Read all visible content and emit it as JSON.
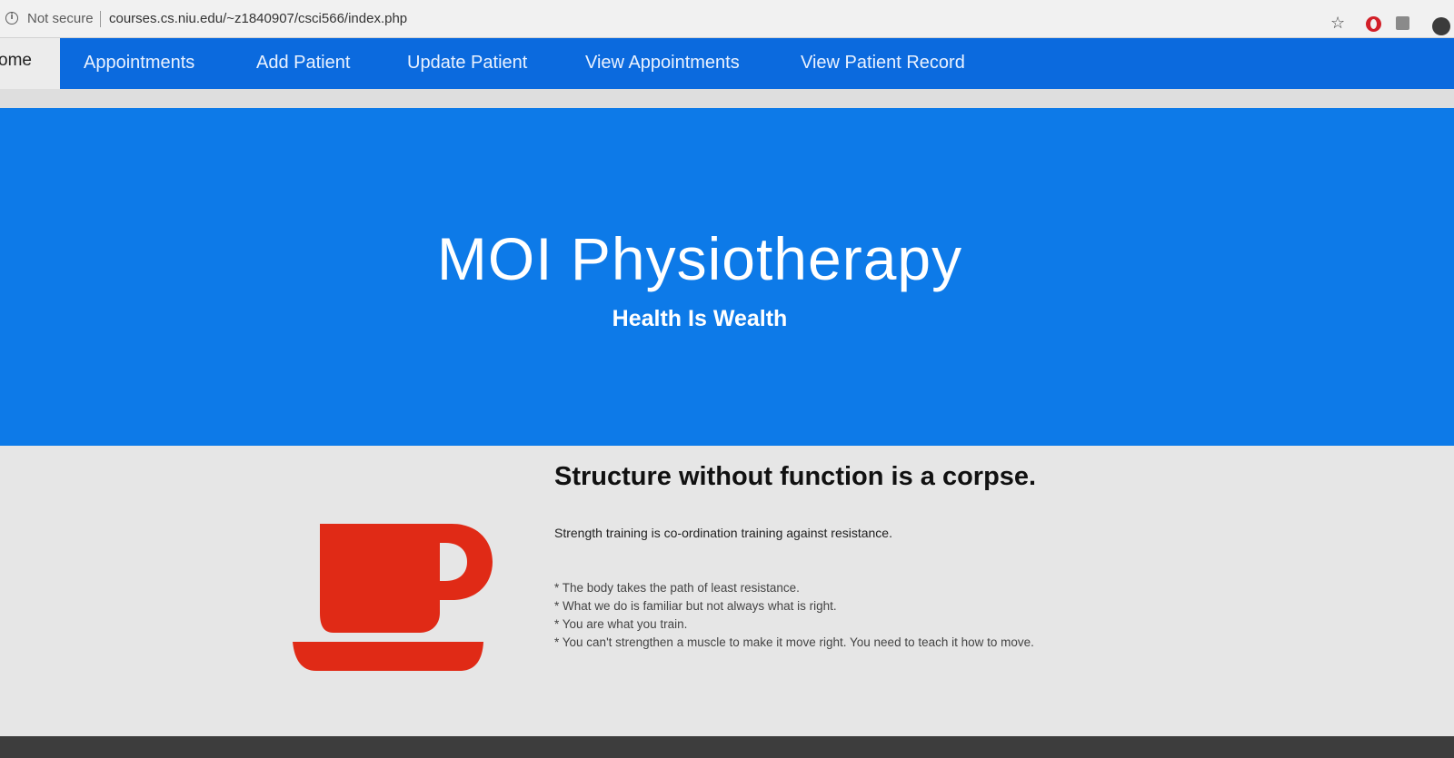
{
  "browser": {
    "security_label": "Not secure",
    "url": "courses.cs.niu.edu/~z1840907/csci566/index.php",
    "icons": [
      "info-icon",
      "star-icon",
      "opera-icon",
      "extension-icon",
      "avatar"
    ]
  },
  "nav": {
    "home_label": "ome",
    "items": [
      {
        "label": "Appointments"
      },
      {
        "label": "Add Patient"
      },
      {
        "label": "Update Patient"
      },
      {
        "label": "View Appointments"
      },
      {
        "label": "View Patient Record"
      }
    ]
  },
  "hero": {
    "title": "MOI Physiotherapy",
    "subtitle": "Health Is Wealth"
  },
  "content": {
    "heading": "Structure without function is a corpse.",
    "lead": "Strength training is co-ordination training against resistance.",
    "quotes": [
      "The body takes the path of least resistance.",
      "What we do is familiar but not always what is right.",
      "You are what you train.",
      "You can't strengthen a muscle to make it move right. You need to teach it how to move."
    ],
    "icon": "coffee-cup-icon"
  },
  "colors": {
    "nav": "#0b6ade",
    "hero": "#0d7ae8",
    "cup": "#e02a16",
    "content_bg": "#e6e6e6"
  }
}
